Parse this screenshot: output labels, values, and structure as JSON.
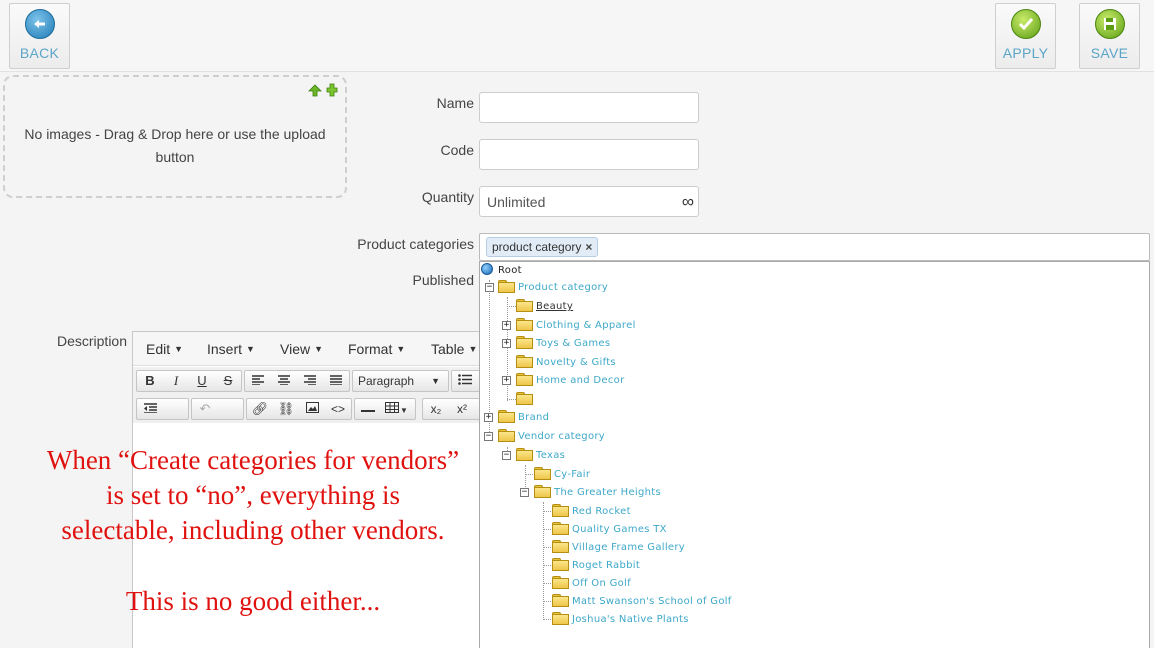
{
  "toolbar": {
    "back_label": "BACK",
    "apply_label": "APPLY",
    "save_label": "SAVE"
  },
  "dropzone": {
    "text": "No images - Drag & Drop here or use the upload button",
    "upload_icon": "upload-add-icon"
  },
  "form": {
    "name_label": "Name",
    "name_value": "",
    "code_label": "Code",
    "code_value": "",
    "quantity_label": "Quantity",
    "quantity_value": "Unlimited",
    "quantity_icon": "∞",
    "categories_label": "Product categories",
    "categories_tag": "product category",
    "tag_remove": "×",
    "published_label": "Published",
    "description_label": "Description"
  },
  "tree": {
    "root": "Root",
    "nodes": [
      {
        "label": "Product category"
      },
      {
        "label": "Beauty"
      },
      {
        "label": "Clothing & Apparel"
      },
      {
        "label": "Toys & Games"
      },
      {
        "label": "Novelty & Gifts"
      },
      {
        "label": "Home and Decor"
      },
      {
        "label": ""
      },
      {
        "label": "Brand"
      },
      {
        "label": "Vendor category"
      },
      {
        "label": "Texas"
      },
      {
        "label": "Cy-Fair"
      },
      {
        "label": "The Greater Heights"
      },
      {
        "label": "Red Rocket"
      },
      {
        "label": "Quality Games TX"
      },
      {
        "label": "Village Frame Gallery"
      },
      {
        "label": "Roget Rabbit"
      },
      {
        "label": "Off On Golf"
      },
      {
        "label": "Matt Swanson's School of Golf"
      },
      {
        "label": "Joshua's Native Plants"
      }
    ]
  },
  "editor": {
    "menus": [
      "Edit",
      "Insert",
      "View",
      "Format",
      "Table"
    ],
    "format_select": "Paragraph",
    "row1": [
      "B",
      "I",
      "U",
      "S"
    ],
    "row2_sub": "x₂",
    "row2_sup": "x²"
  },
  "annotation": {
    "line1": "When “Create categories for vendors”",
    "line2": "is set to “no”, everything is",
    "line3": "selectable, including other vendors.",
    "line4": "This is no good either...",
    "color": "#e0120f"
  }
}
